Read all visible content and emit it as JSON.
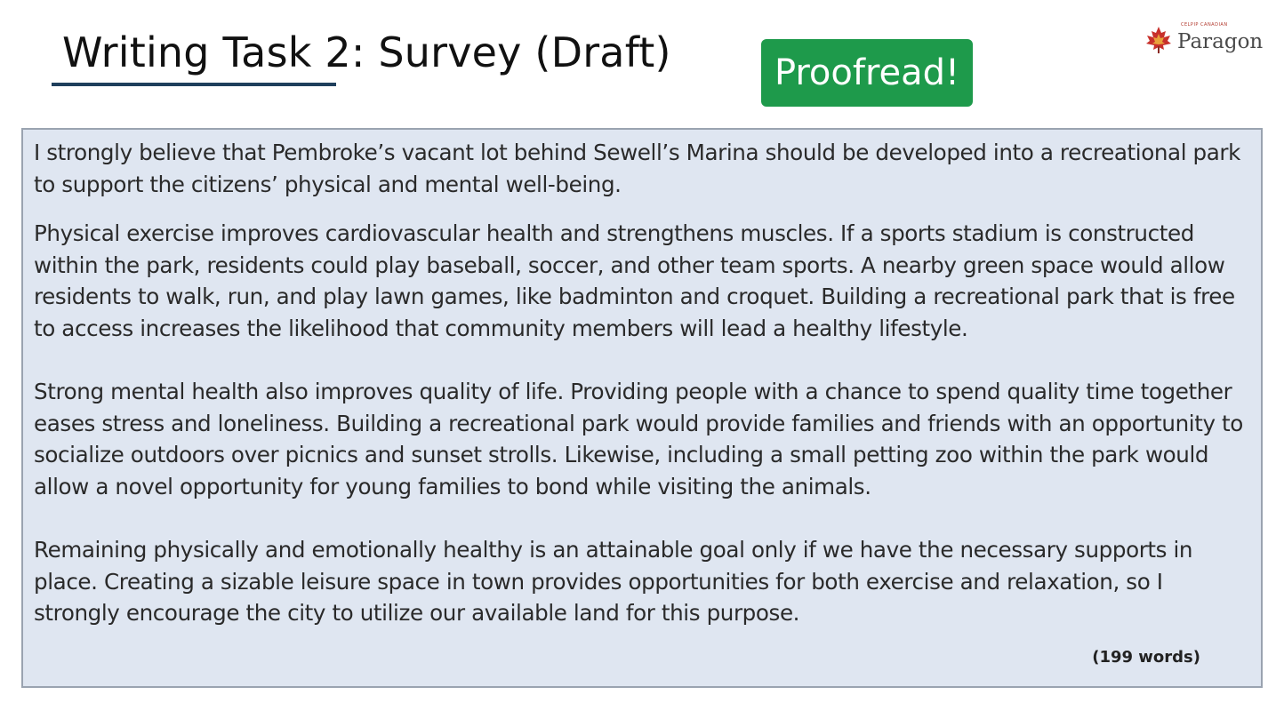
{
  "header": {
    "title": "Writing Task 2: Survey (Draft)",
    "proofread_label": "Proofread!",
    "button_color": "#1e9a4b"
  },
  "brand": {
    "tagline": "CELPIP CANADIAN",
    "name": "Paragon",
    "logo_icon": "maple-leaf-icon",
    "accent": "#c8302b"
  },
  "essay": {
    "paragraphs": [
      "I strongly believe that Pembroke’s vacant lot behind Sewell’s Marina should be developed into a recreational park to support the citizens’ physical and mental well-being.",
      "Physical exercise improves cardiovascular health and strengthens muscles. If a sports stadium is constructed within the park, residents could play baseball, soccer, and other team sports. A nearby green space would allow residents to walk, run, and play lawn games, like badminton and croquet. Building a recreational park that is free to access increases the likelihood that community members will lead a healthy lifestyle.",
      "Strong mental health also improves quality of life. Providing people with a chance to spend quality time together eases stress and loneliness. Building a recreational park would provide families and friends with an opportunity to socialize outdoors over picnics and sunset strolls. Likewise, including a small petting zoo within the park would allow a novel opportunity for young families to bond while visiting the animals.",
      "Remaining physically and emotionally healthy is an attainable goal only if we have the necessary supports in place. Creating a sizable leisure space in town provides opportunities for both exercise and relaxation, so I strongly encourage the city to utilize our available land for this purpose."
    ],
    "word_count": "(199 words)",
    "panel_color": "#dfe6f1"
  }
}
